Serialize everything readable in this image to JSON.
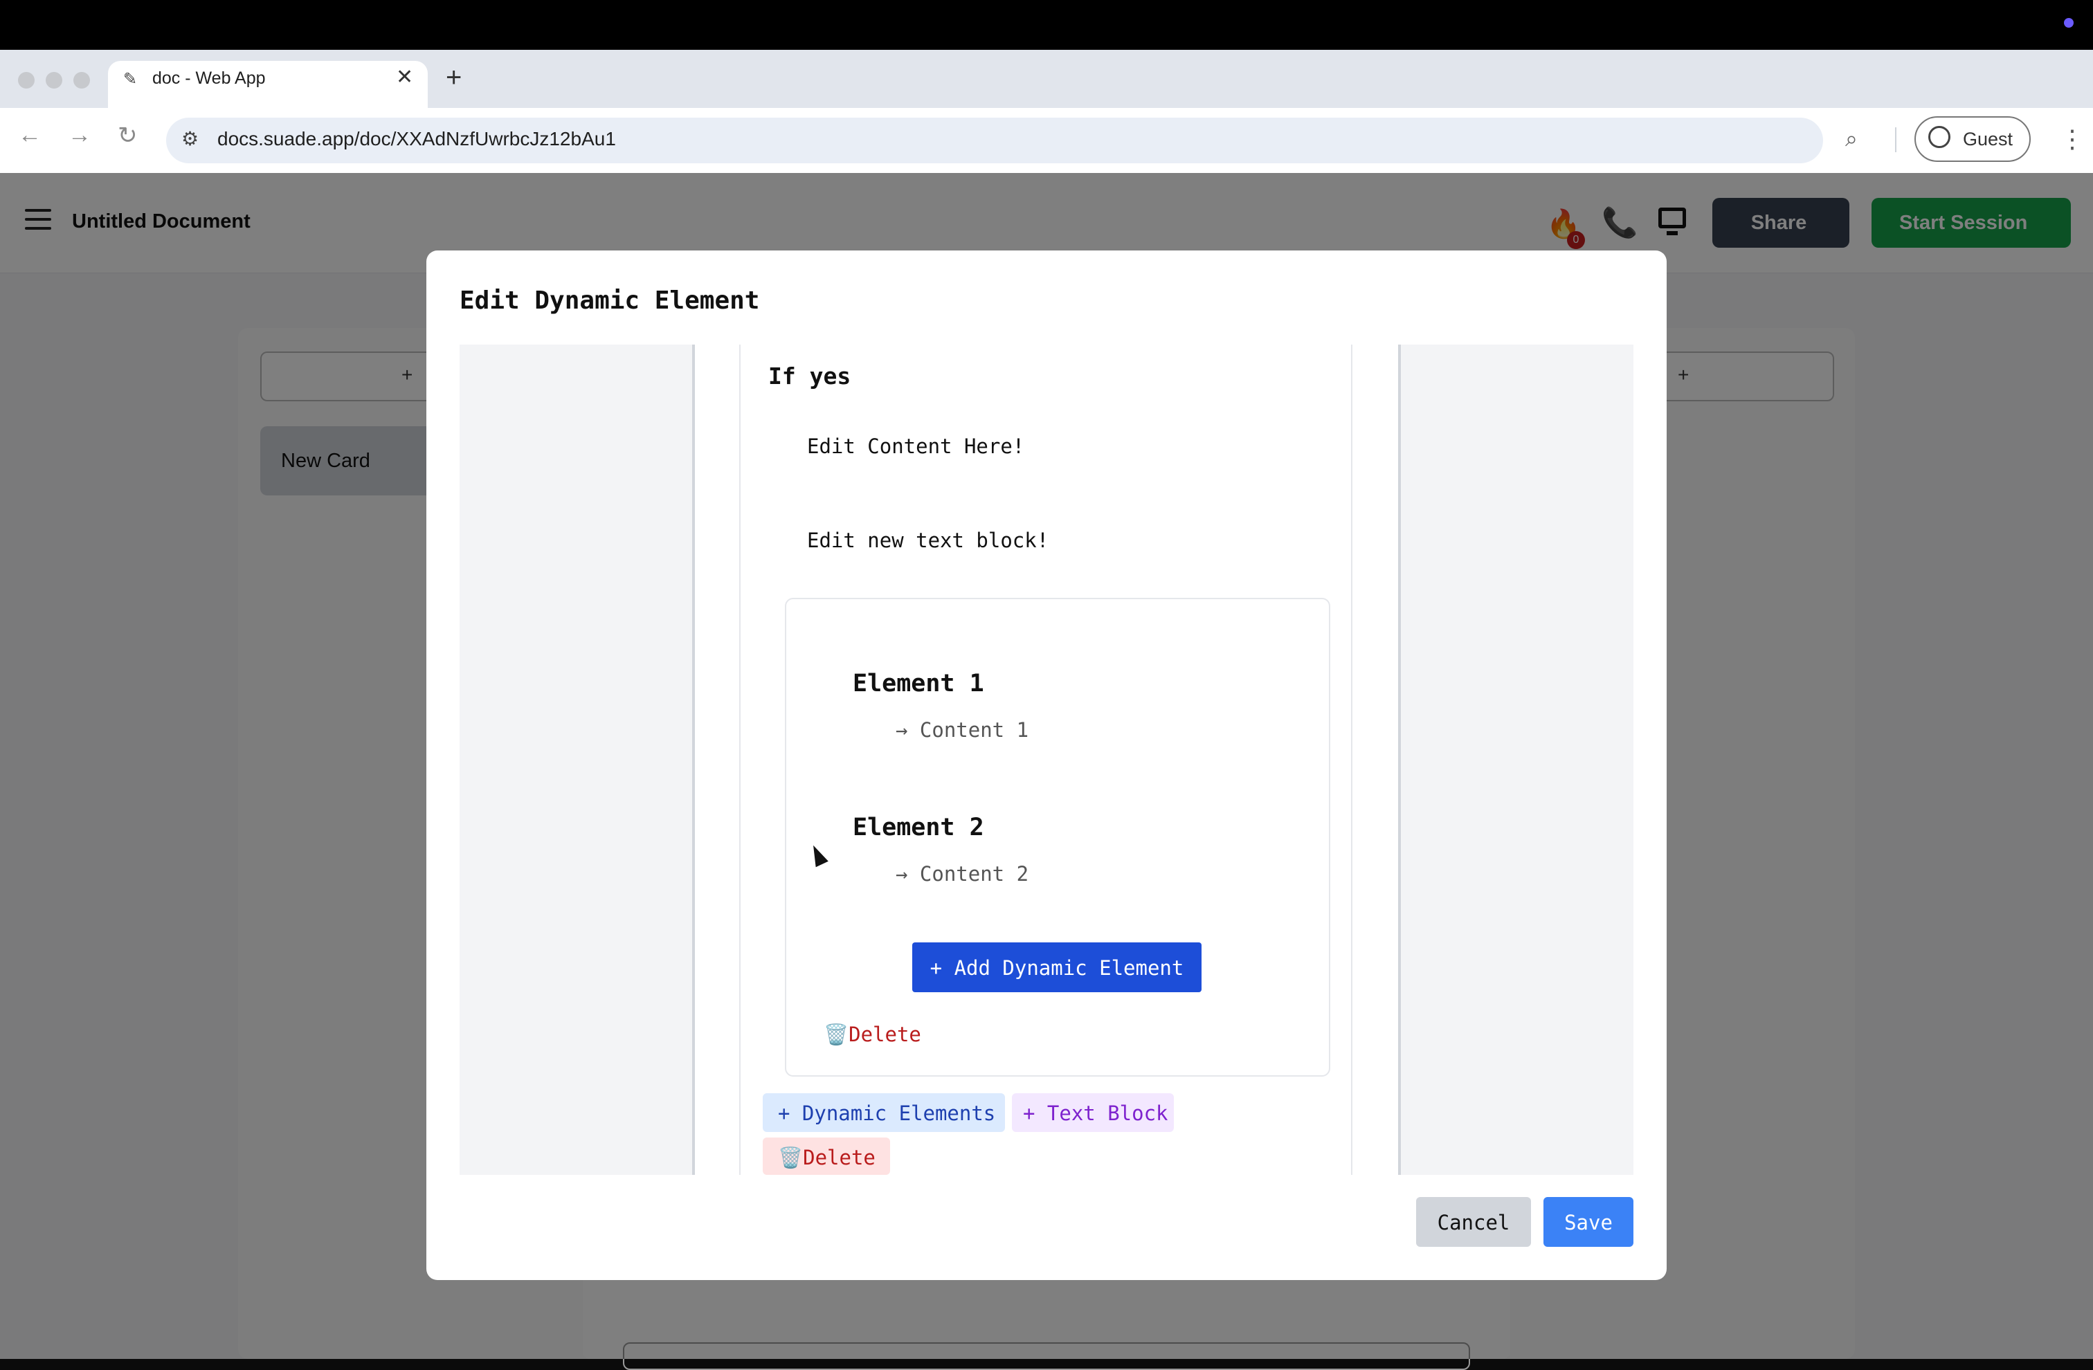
{
  "browser": {
    "tab_title": "doc - Web App",
    "tab_close": "✕",
    "new_tab": "+",
    "url": "docs.suade.app/doc/XXAdNzfUwrbcJz12bAu1",
    "profile_label": "Guest",
    "nav": {
      "back": "←",
      "forward": "→",
      "reload": "↻",
      "menu": "⋮"
    }
  },
  "app": {
    "doc_title": "Untitled Document",
    "notification_count": "0",
    "share_label": "Share",
    "start_session_label": "Start Session",
    "left_add_plus": "+",
    "right_add_plus": "+",
    "new_card_label": "New Card"
  },
  "modal": {
    "title": "Edit Dynamic Element",
    "branch_label": "If yes",
    "text_blocks": [
      "Edit Content Here!",
      "Edit new text block!"
    ],
    "dynamic_elements": [
      {
        "title": "Element 1",
        "content": "→ Content 1"
      },
      {
        "title": "Element 2",
        "content": "→ Content 2"
      }
    ],
    "add_dynamic_element_label": "+ Add Dynamic Element",
    "inner_delete_label": "🗑️Delete",
    "chip_dynamic_elements": "+ Dynamic Elements",
    "chip_text_block": "+ Text Block",
    "chip_delete": "🗑️Delete",
    "cancel_label": "Cancel",
    "save_label": "Save"
  },
  "colors": {
    "primary_blue": "#1d4ed8",
    "save_blue": "#3b82f6",
    "start_green": "#16a34a",
    "share_dark": "#374151",
    "delete_red": "#b91c1c"
  }
}
